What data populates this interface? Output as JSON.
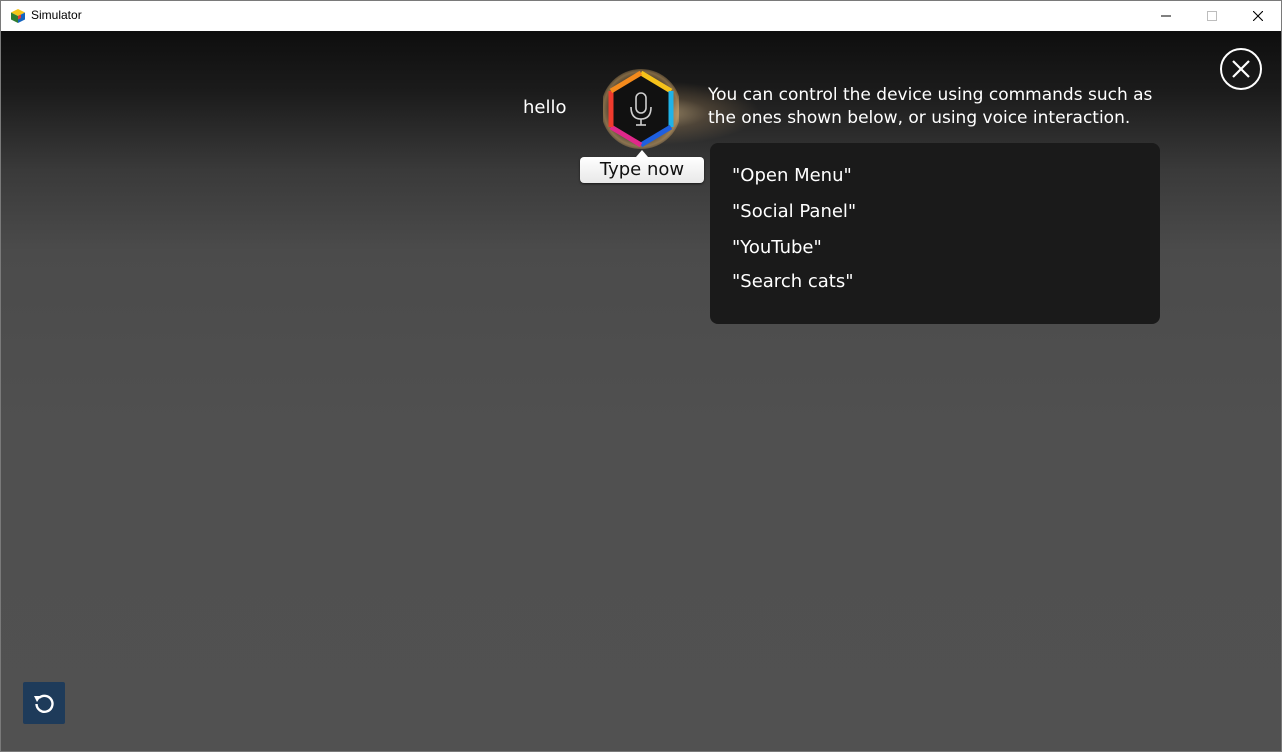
{
  "window": {
    "title": "Simulator",
    "controls": {
      "minimize": "minimize-icon",
      "maximize": "maximize-icon",
      "close": "close-icon"
    }
  },
  "voice": {
    "recognized_text": "hello",
    "mic_icon": "microphone-icon",
    "type_now_label": "Type now",
    "hint_line1": "You can control the device using commands such as",
    "hint_line2": "the ones shown below, or using voice interaction.",
    "commands": [
      "\"Open Menu\"",
      "\"Social Panel\"",
      "\"YouTube\"",
      "\"Search cats\""
    ]
  },
  "overlay_close_icon": "close-circle-icon",
  "refresh_icon": "refresh-icon",
  "colors": {
    "stage_bg": "#505050",
    "command_box": "#1a1a1a",
    "refresh_btn": "#1e3b5a"
  }
}
